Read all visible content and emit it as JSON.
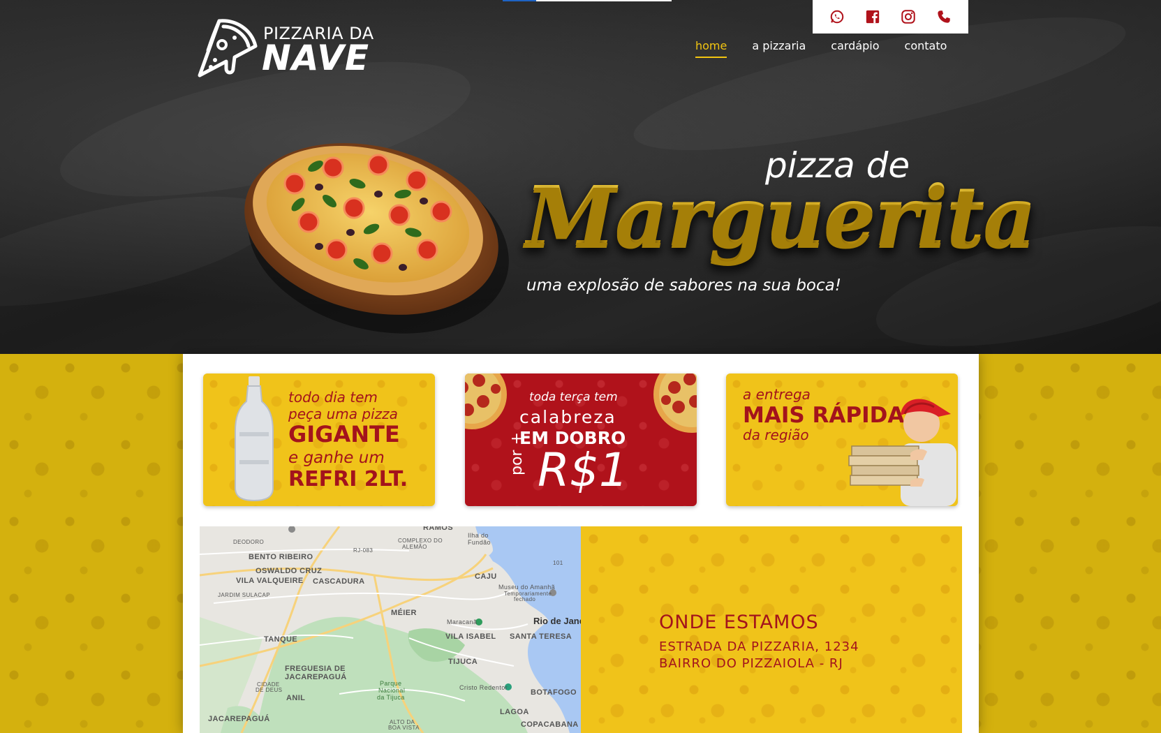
{
  "brand": {
    "line1": "PIZZARIA DA",
    "line2": "NAVE",
    "primary_color": "#f2c511",
    "accent_red": "#a3131c"
  },
  "social": {
    "icons": [
      "whatsapp-icon",
      "facebook-icon",
      "instagram-icon",
      "phone-icon"
    ],
    "icon_color": "#b0121b"
  },
  "nav": {
    "items": [
      {
        "label": "home",
        "active": true
      },
      {
        "label": "a pizzaria",
        "active": false
      },
      {
        "label": "cardápio",
        "active": false
      },
      {
        "label": "contato",
        "active": false
      }
    ]
  },
  "hero": {
    "pre": "pizza de",
    "main": "Marguerita",
    "sub": "uma explosão de sabores na sua boca!"
  },
  "banners": [
    {
      "line1": "todo dia tem",
      "line2": "peça uma pizza",
      "line3": "GIGANTE",
      "line4": "e ganhe um",
      "line5": "REFRI 2LT."
    },
    {
      "line1": "toda terça tem",
      "line2": "calabreza",
      "line3": "EM DOBRO",
      "line4": "por +",
      "line5": "R$1"
    },
    {
      "line1": "a entrega",
      "line2": "MAIS RÁPIDA",
      "line3": "da região"
    }
  ],
  "map": {
    "labels": {
      "ramos": "RAMOS",
      "ilha": "Ilha do",
      "fundao": "Fundão",
      "deodoro": "DEODORO",
      "complexo1": "COMPLEXO DO",
      "complexo2": "ALEMÃO",
      "rj083": "RJ-083",
      "br101": "101",
      "bento": "BENTO RIBEIRO",
      "oswaldo": "OSWALDO CRUZ",
      "valqueire": "VILA VALQUEIRE",
      "cascadura": "CASCADURA",
      "caju": "CAJU",
      "museu1": "Museu do Amanhã",
      "museu2": "Temporariamente",
      "museu3": "fechado",
      "jardim": "JARDIM SULACAP",
      "meier": "MÉIER",
      "maracana": "Maracanã",
      "rio": "Rio de Jane",
      "tanque": "TANQUE",
      "vilaisabel": "VILA ISABEL",
      "santateresa": "SANTA TERESA",
      "tijuca": "TIJUCA",
      "freguesia1": "FREGUESIA DE",
      "freguesia2": "JACAREPAGUÁ",
      "cidade1": "CIDADE",
      "cidade2": "DE DEUS",
      "parque1": "Parque",
      "parque2": "Nacional",
      "parque3": "da Tijuca",
      "cristo": "Cristo Redentor",
      "botafogo": "BOTAFOGO",
      "anil": "ANIL",
      "lagoa": "LAGOA",
      "jacarepagua": "JACAREPAGUÁ",
      "altoboa1": "ALTO DA",
      "altoboa2": "BOA VISTA",
      "copacabana": "COPACABANA"
    }
  },
  "location": {
    "title": "ONDE ESTAMOS",
    "address_line1": "ESTRADA DA PIZZARIA, 1234",
    "address_line2": "BAIRRO DO PIZZAIOLA - RJ"
  }
}
